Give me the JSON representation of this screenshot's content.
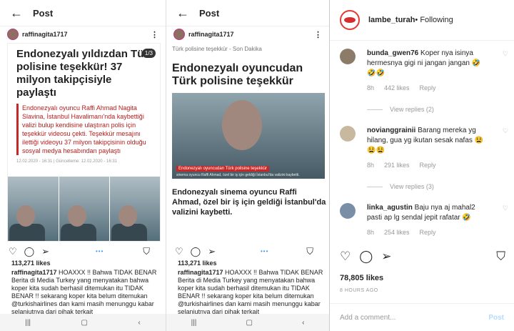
{
  "left_screen": {
    "title": "Post",
    "username": "raffinagita1717",
    "headline": "Endonezyalı yıldızdan Türk polisine teşekkür! 37 milyon takipçisiyle paylaştı",
    "counter": "1/3",
    "lead": "Endonezyalı oyuncu Raffi Ahmad Nagita Slavina, İstanbul Havalimanı'nda kaybettiği valizi bulup kendisine ulaştıran polis için teşekkür videosu çekti. Teşekkür mesajını ilettiği videoyu 37 milyon takipçisinin olduğu sosyal medya hesabından paylaştı",
    "date": "12.02.2020 - 16:31 | Güncelleme: 12.02.2020 - 16:31",
    "likes": "113,271 likes",
    "caption_user": "raffinagita1717",
    "caption": " HOAXXX !! Bahwa TIDAK BENAR Berita di Media Turkey yang menyatakan bahwa koper kita sudah berhasil ditemukan itu TIDAK BENAR !! sekarang koper kita belum ditemukan @turkishairlines dan kami masih menunggu kabar selanjutnya dari pihak terkait"
  },
  "middle_screen": {
    "title": "Post",
    "username": "raffinagita1717",
    "source": "Türk polisine teşekkür - Son Dakika",
    "headline": "Endonezyalı oyuncudan Türk polisine teşekkür",
    "video_banner": "Endonezyalı oyuncudan Türk polisine teşekkür",
    "video_sub": "sinema oyuncu Raffi Ahmad, özel bir iş için geldiği İstanbul'da valizini kaybetti.",
    "body": "Endonezyalı sinema oyuncu Raffi Ahmad, özel bir iş için geldiği İstanbul'da valizini kaybetti.",
    "likes": "113,271 likes",
    "caption_user": "raffinagita1717",
    "caption": " HOAXXX !! Bahwa TIDAK BENAR Berita di Media Turkey yang menyatakan bahwa koper kita sudah berhasil ditemukan itu TIDAK BENAR !! sekarang koper kita belum ditemukan @turkishairlines dan kami masih menunggu kabar selanjutnya dari pihak terkait"
  },
  "right_panel": {
    "account": "lambe_turah",
    "following": " • Following",
    "comments": [
      {
        "user": "bunda_gwen76",
        "text": " Koper nya isinya hermesnya gigi ni jangan jangan 🤣🤣🤣",
        "time": "8h",
        "likes": "442 likes",
        "reply": "Reply",
        "view_replies": "View replies (2)"
      },
      {
        "user": "noviangg​rainii",
        "text": " Barang mereka yg hilang, gua yg ikutan sesak nafas 😫😫😫",
        "time": "8h",
        "likes": "291 likes",
        "reply": "Reply",
        "view_replies": "View replies (3)"
      },
      {
        "user": "linka_agustin",
        "text": " Baju nya aj mahal2 pasti ap lg sendal jepit rafatar 🤣",
        "time": "8h",
        "likes": "254 likes",
        "reply": "Reply"
      }
    ],
    "likes": "78,805 likes",
    "time_ago": "8 HOURS AGO",
    "add_comment_placeholder": "Add a comment...",
    "post_label": "Post"
  },
  "icons": {
    "back": "arrow-left-icon",
    "heart": "heart-icon",
    "comment": "comment-icon",
    "share": "send-icon",
    "save": "bookmark-icon"
  }
}
